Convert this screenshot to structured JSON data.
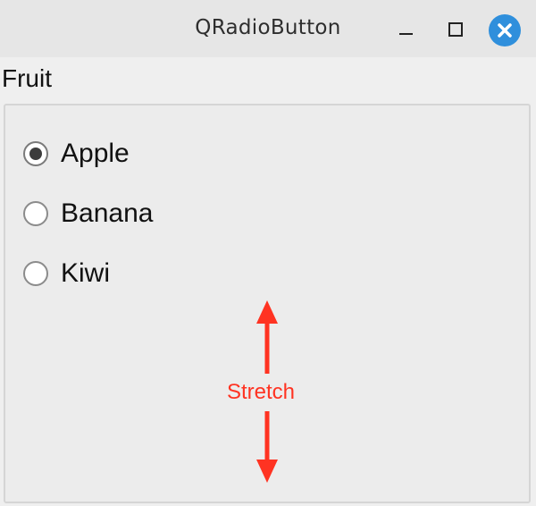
{
  "window": {
    "title": "QRadioButton",
    "controls": {
      "minimize": "minimize-icon",
      "maximize": "maximize-icon",
      "close": "close-icon"
    }
  },
  "group": {
    "title": "Fruit",
    "options": [
      {
        "label": "Apple",
        "checked": true
      },
      {
        "label": "Banana",
        "checked": false
      },
      {
        "label": "Kiwi",
        "checked": false
      }
    ]
  },
  "annotation": {
    "label": "Stretch",
    "color": "#ff3322"
  }
}
